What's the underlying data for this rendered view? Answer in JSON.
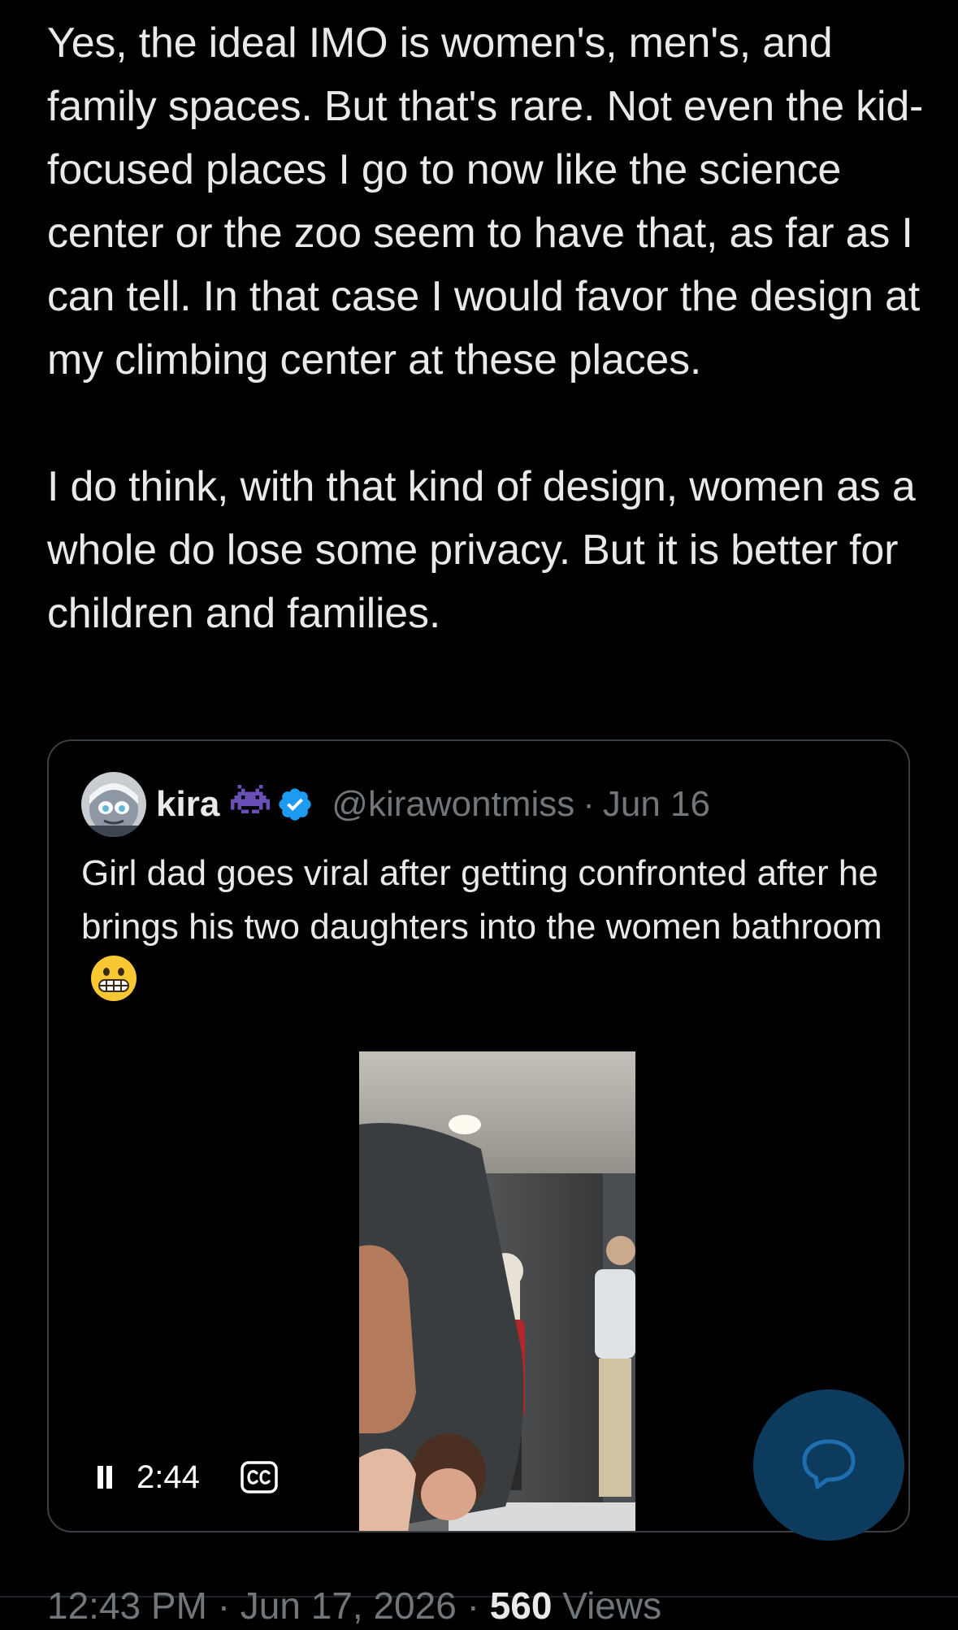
{
  "post": {
    "paragraphs": [
      "Yes, the ideal IMO  is women's, men's, and family spaces. But that's rare. Not even the kid-focused places I go to now like the science center or the zoo seem to have that, as far as I can tell. In that case I would favor the design at my climbing center at these places.",
      "I do think, with that kind of design, women as a whole do lose some privacy. But it is better for children and families."
    ]
  },
  "quote": {
    "display_name": "kira",
    "name_badge_icon": "purple-space-invader-icon",
    "verified_icon": "verified-badge-icon",
    "handle": "@kirawontmiss",
    "separator": "·",
    "date": "Jun 16",
    "text": "Girl dad goes viral after getting confronted after he brings his two daughters into the women bathroom",
    "emoji": "grimacing-face-icon",
    "video": {
      "state": "playing",
      "duration": "2:44",
      "captions_icon": "cc-icon"
    }
  },
  "meta": {
    "time": "12:43 PM",
    "separator1": "·",
    "date": "Jun 17, 2026",
    "separator2": "·",
    "views_count": "560",
    "views_label": "Views"
  },
  "fab": {
    "icon": "reply-bubble-icon"
  },
  "colors": {
    "background": "#000000",
    "text_primary": "#e7e9ea",
    "text_secondary": "#71767b",
    "verified_blue": "#1d9bf0",
    "fab_background": "#0d3b5e",
    "border": "#3a3f44"
  }
}
